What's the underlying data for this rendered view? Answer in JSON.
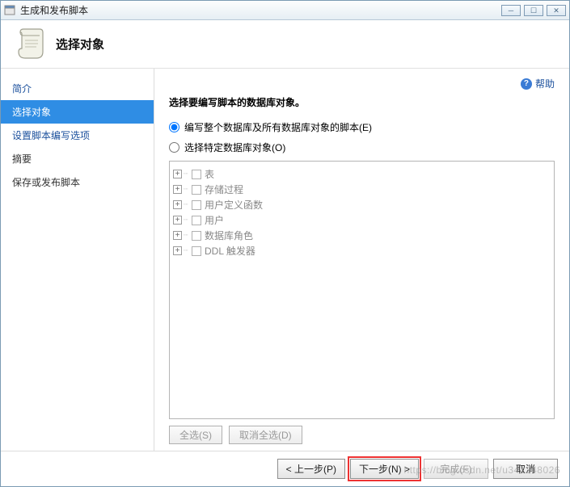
{
  "titlebar": {
    "title": "生成和发布脚本"
  },
  "header": {
    "title": "选择对象"
  },
  "sidebar": {
    "items": [
      {
        "label": "简介",
        "kind": "link"
      },
      {
        "label": "选择对象",
        "kind": "active"
      },
      {
        "label": "设置脚本编写选项",
        "kind": "link"
      },
      {
        "label": "摘要",
        "kind": "plain"
      },
      {
        "label": "保存或发布脚本",
        "kind": "plain"
      }
    ]
  },
  "help": {
    "label": "帮助"
  },
  "main": {
    "instruction": "选择要编写脚本的数据库对象。",
    "radios": [
      {
        "label": "编写整个数据库及所有数据库对象的脚本(E)",
        "checked": true
      },
      {
        "label": "选择特定数据库对象(O)",
        "checked": false
      }
    ],
    "tree": [
      {
        "label": "表"
      },
      {
        "label": "存储过程"
      },
      {
        "label": "用户定义函数"
      },
      {
        "label": "用户"
      },
      {
        "label": "数据库角色"
      },
      {
        "label": "DDL 触发器"
      }
    ],
    "select_buttons": {
      "select_all": "全选(S)",
      "deselect_all": "取消全选(D)"
    }
  },
  "footer": {
    "prev": "< 上一步(P)",
    "next": "下一步(N) >",
    "finish": "完成(F)",
    "cancel": "取消"
  },
  "watermark": "https://blog.csdn.net/u341248026"
}
